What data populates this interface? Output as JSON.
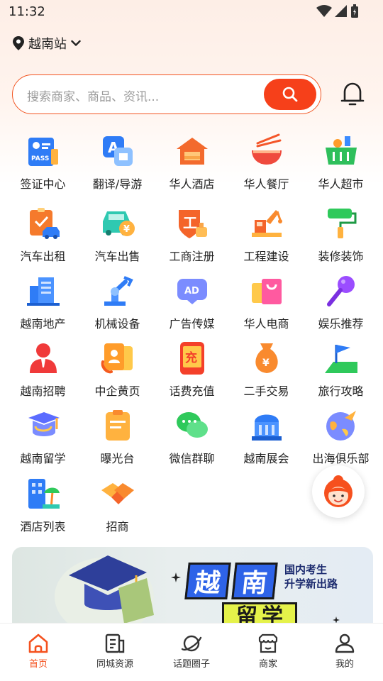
{
  "status_bar": {
    "time": "11:32"
  },
  "location": {
    "name": "越南站"
  },
  "search": {
    "placeholder": "搜索商家、商品、资讯..."
  },
  "grid": {
    "items": [
      {
        "label": "签证中心",
        "icon": "visa-icon"
      },
      {
        "label": "翻译/导游",
        "icon": "translate-icon"
      },
      {
        "label": "华人酒店",
        "icon": "hotel-icon"
      },
      {
        "label": "华人餐厅",
        "icon": "restaurant-icon"
      },
      {
        "label": "华人超市",
        "icon": "supermarket-icon"
      },
      {
        "label": "汽车出租",
        "icon": "car-rental-icon"
      },
      {
        "label": "汽车出售",
        "icon": "car-sale-icon"
      },
      {
        "label": "工商注册",
        "icon": "business-registration-icon"
      },
      {
        "label": "工程建设",
        "icon": "construction-icon"
      },
      {
        "label": "装修装饰",
        "icon": "decoration-icon"
      },
      {
        "label": "越南地产",
        "icon": "real-estate-icon"
      },
      {
        "label": "机械设备",
        "icon": "machinery-icon"
      },
      {
        "label": "广告传媒",
        "icon": "advertising-icon"
      },
      {
        "label": "华人电商",
        "icon": "ecommerce-icon"
      },
      {
        "label": "娱乐推荐",
        "icon": "entertainment-icon"
      },
      {
        "label": "越南招聘",
        "icon": "recruitment-icon"
      },
      {
        "label": "中企黄页",
        "icon": "yellow-pages-icon"
      },
      {
        "label": "话费充值",
        "icon": "phone-topup-icon"
      },
      {
        "label": "二手交易",
        "icon": "second-hand-icon"
      },
      {
        "label": "旅行攻略",
        "icon": "travel-guide-icon"
      },
      {
        "label": "越南留学",
        "icon": "study-abroad-icon"
      },
      {
        "label": "曝光台",
        "icon": "exposure-icon"
      },
      {
        "label": "微信群聊",
        "icon": "wechat-group-icon"
      },
      {
        "label": "越南展会",
        "icon": "exhibition-icon"
      },
      {
        "label": "出海俱乐部",
        "icon": "overseas-club-icon"
      },
      {
        "label": "酒店列表",
        "icon": "hotel-list-icon"
      },
      {
        "label": "招商",
        "icon": "investment-icon"
      }
    ]
  },
  "banner": {
    "title_chars": [
      "越",
      "南",
      "留",
      "学"
    ],
    "line1": "国内考生",
    "line2": "升学新出路"
  },
  "tabbar": {
    "tabs": [
      {
        "label": "首页",
        "icon": "home-icon",
        "active": true
      },
      {
        "label": "同城资源",
        "icon": "resources-icon",
        "active": false
      },
      {
        "label": "话题圈子",
        "icon": "planet-icon",
        "active": false
      },
      {
        "label": "商家",
        "icon": "store-icon",
        "active": false
      },
      {
        "label": "我的",
        "icon": "profile-icon",
        "active": false
      }
    ]
  },
  "colors": {
    "accent": "#f6401a",
    "active_tab": "#f4511e"
  }
}
